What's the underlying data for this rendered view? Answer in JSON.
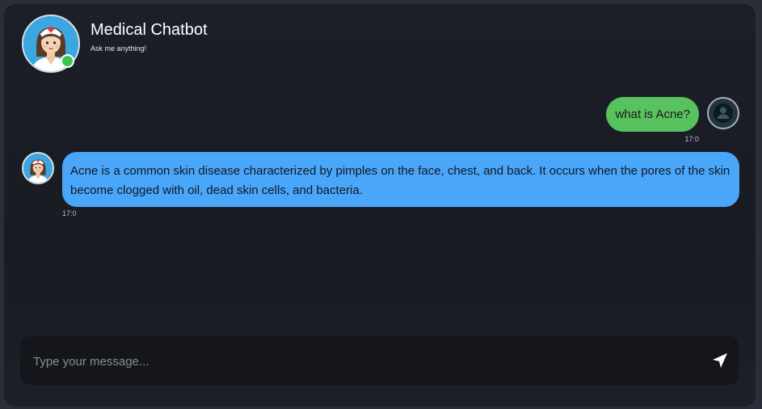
{
  "header": {
    "title": "Medical Chatbot",
    "subtitle": "Ask me anything!",
    "avatar_icon": "nurse-avatar-icon",
    "status": "online"
  },
  "messages": [
    {
      "sender": "user",
      "text": "what is Acne?",
      "time": "17:0",
      "avatar_icon": "user-icon"
    },
    {
      "sender": "bot",
      "text": "Acne is a common skin disease characterized by pimples on the face, chest, and back. It occurs when the pores of the skin become clogged with oil, dead skin cells, and bacteria.",
      "time": "17:0",
      "avatar_icon": "nurse-avatar-icon"
    }
  ],
  "input": {
    "placeholder": "Type your message...",
    "value": ""
  },
  "send_icon": "send-icon",
  "colors": {
    "user_bubble": "#58c25e",
    "bot_bubble": "#4aa6f9",
    "online": "#3cc453",
    "background": "#1c1f28"
  }
}
